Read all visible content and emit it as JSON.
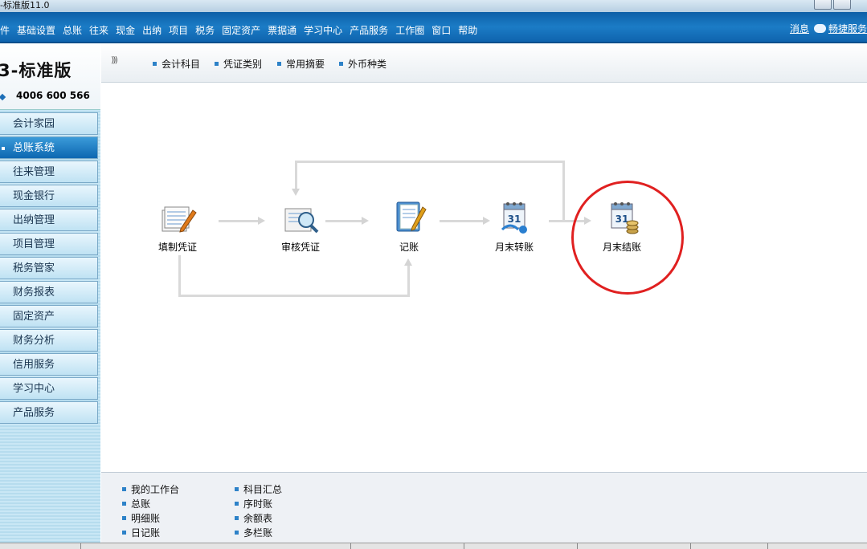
{
  "window": {
    "title": "-标准版11.0"
  },
  "menu": {
    "items": [
      "件",
      "基础设置",
      "总账",
      "往来",
      "现金",
      "出纳",
      "项目",
      "税务",
      "固定资产",
      "票据通",
      "学习中心",
      "产品服务",
      "工作圈",
      "窗口",
      "帮助"
    ],
    "messages": "消息",
    "service": "畅捷服务"
  },
  "brand": {
    "name": "3-标准版",
    "phone": "4006 600 566"
  },
  "sidebar": {
    "items": [
      {
        "label": "会计家园"
      },
      {
        "label": "总账系统",
        "active": true
      },
      {
        "label": "往来管理"
      },
      {
        "label": "现金银行"
      },
      {
        "label": "出纳管理"
      },
      {
        "label": "项目管理"
      },
      {
        "label": "税务管家"
      },
      {
        "label": "财务报表"
      },
      {
        "label": "固定资产"
      },
      {
        "label": "财务分析"
      },
      {
        "label": "信用服务"
      },
      {
        "label": "学习中心"
      },
      {
        "label": "产品服务"
      }
    ]
  },
  "topnav": {
    "items": [
      "会计科目",
      "凭证类别",
      "常用摘要",
      "外币种类"
    ]
  },
  "flow": {
    "nodes": [
      {
        "label": "填制凭证",
        "icon": "voucher-edit-icon"
      },
      {
        "label": "审核凭证",
        "icon": "voucher-audit-icon"
      },
      {
        "label": "记账",
        "icon": "bookkeeping-icon"
      },
      {
        "label": "月末转账",
        "icon": "month-end-transfer-icon"
      },
      {
        "label": "月末结账",
        "icon": "month-end-close-icon"
      }
    ],
    "calendar_day": "31"
  },
  "quicklinks": {
    "col1": [
      "我的工作台",
      "总账",
      "明细账",
      "日记账"
    ],
    "col2": [
      "科目汇总",
      "序时账",
      "余额表",
      "多栏账"
    ]
  },
  "colors": {
    "menubar": "#1b7cc6",
    "highlight_circle": "#e02020",
    "sidebar": "#c9e7f5"
  }
}
